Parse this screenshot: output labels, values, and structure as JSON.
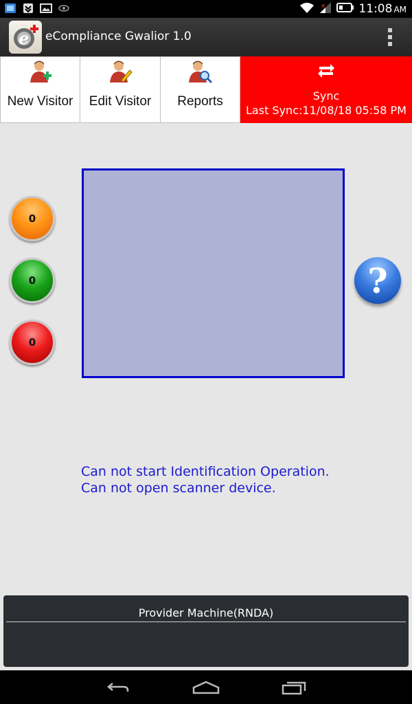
{
  "status_bar": {
    "time": "11:08",
    "ampm": "AM",
    "icons": [
      "app-notification-icon",
      "download-icon",
      "image-icon",
      "eye-icon",
      "wifi-icon",
      "signal-icon",
      "battery-icon"
    ]
  },
  "app_bar": {
    "title": "eCompliance Gwalior 1.0",
    "logo_icon": "ecompliance-logo-icon",
    "menu_icon": "overflow-menu-icon"
  },
  "toolbar": {
    "new_visitor": "New Visitor",
    "edit_visitor": "Edit Visitor",
    "reports": "Reports",
    "sync": "Sync",
    "last_sync": "Last Sync:11/08/18 05:58 PM",
    "sync_color": "#ff0000"
  },
  "counters": {
    "orange": "0",
    "green": "0",
    "red": "0"
  },
  "help": {
    "label": "?"
  },
  "messages": {
    "line1": "Can not start Identification Operation.",
    "line2": "Can not open scanner device."
  },
  "provider": {
    "title": "Provider Machine(RNDA)"
  },
  "colors": {
    "message_text": "#1a1ad0",
    "scan_border": "#0000cc",
    "scan_fill": "#aeb2d4"
  }
}
